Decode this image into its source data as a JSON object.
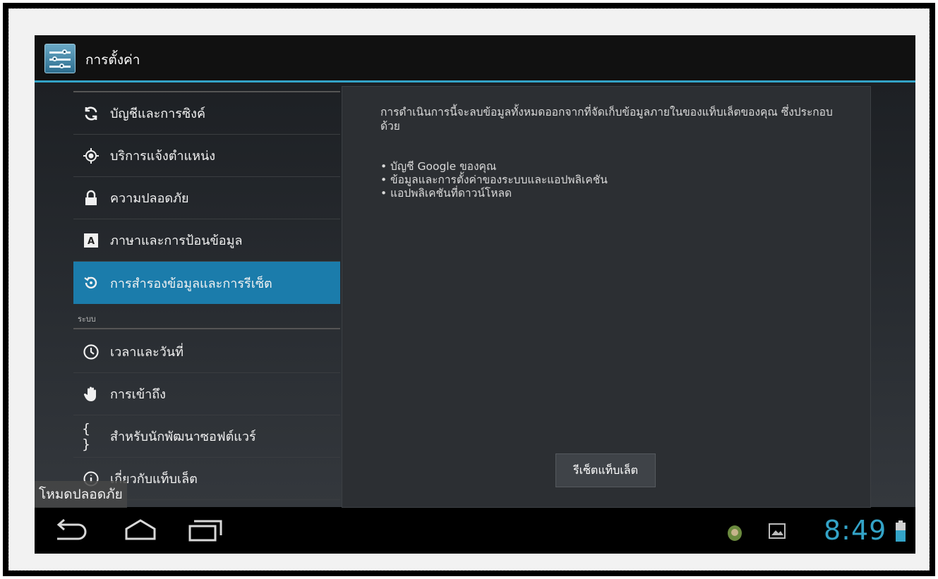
{
  "app": {
    "title": "การตั้งค่า"
  },
  "sidebar": {
    "section_system": "ระบบ",
    "items": [
      {
        "label": "บัญชีและการซิงค์",
        "icon": "sync-icon"
      },
      {
        "label": "บริการแจ้งตำแหน่ง",
        "icon": "location-icon"
      },
      {
        "label": "ความปลอดภัย",
        "icon": "lock-icon"
      },
      {
        "label": "ภาษาและการป้อนข้อมูล",
        "icon": "language-icon"
      },
      {
        "label": "การสำรองข้อมูลและการรีเซ็ต",
        "icon": "backup-restore-icon",
        "selected": true
      },
      {
        "label": "เวลาและวันที่",
        "icon": "clock-icon"
      },
      {
        "label": "การเข้าถึง",
        "icon": "hand-icon"
      },
      {
        "label": "สำหรับนักพัฒนาซอฟต์แวร์",
        "icon": "braces-icon"
      },
      {
        "label": "เกี่ยวกับแท็บเล็ต",
        "icon": "info-icon"
      }
    ]
  },
  "detail": {
    "description": "การดำเนินการนี้จะลบข้อมูลทั้งหมดออกจากที่จัดเก็บข้อมูลภายในของแท็บเล็ตของคุณ ซึ่งประกอบด้วย",
    "bullets": [
      "บัญชี Google ของคุณ",
      "ข้อมูลและการตั้งค่าของระบบและแอปพลิเคชัน",
      "แอปพลิเคชันที่ดาวน์โหลด"
    ],
    "reset_button": "รีเซ็ตแท็บเล็ต"
  },
  "overlay": {
    "safe_mode": "โหมดปลอดภัย"
  },
  "statusbar": {
    "time": "8:49"
  },
  "colors": {
    "accent": "#33a3c7",
    "selected": "#1b7cab"
  }
}
